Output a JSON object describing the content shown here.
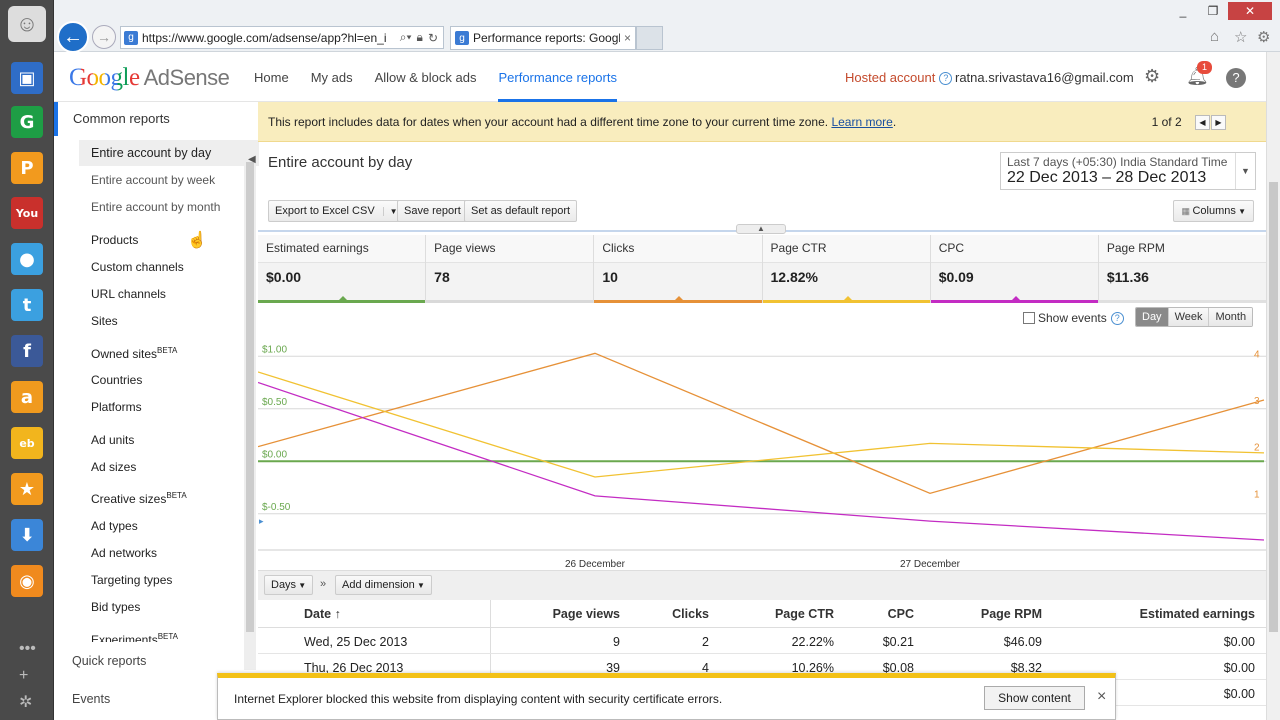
{
  "browser": {
    "url": "https://www.google.com/adsense/app?hl=en_i",
    "tab_title": "Performance reports: Googl...",
    "tab_close": "×"
  },
  "dock_icons": [
    "smiley-icon",
    "mobile-app-icon",
    "g-app-icon",
    "paypal-icon",
    "youtube-icon",
    "apple-icon",
    "twitter-icon",
    "facebook-icon",
    "amazon-icon",
    "ebay-icon",
    "star-icon",
    "download-icon",
    "rss-icon"
  ],
  "header": {
    "logo_google": "Google",
    "logo_product": "AdSense",
    "nav": [
      "Home",
      "My ads",
      "Allow & block ads",
      "Performance reports"
    ],
    "hosted": "Hosted account",
    "help_glyph": "?",
    "email": "ratna.srivastava16@gmail.com",
    "notif_count": "1"
  },
  "sidebar": {
    "common_reports": "Common reports",
    "items": [
      {
        "label": "Entire account by day",
        "selected": true
      },
      {
        "label": "Entire account by week"
      },
      {
        "label": "Entire account by month"
      },
      {
        "label": "Products"
      },
      {
        "label": "Custom channels"
      },
      {
        "label": "URL channels"
      },
      {
        "label": "Sites"
      },
      {
        "label": "Owned sites",
        "sup": "BETA"
      },
      {
        "label": "Countries"
      },
      {
        "label": "Platforms"
      },
      {
        "label": "Ad units"
      },
      {
        "label": "Ad sizes"
      },
      {
        "label": "Creative sizes",
        "sup": "BETA"
      },
      {
        "label": "Ad types"
      },
      {
        "label": "Ad networks"
      },
      {
        "label": "Targeting types"
      },
      {
        "label": "Bid types"
      },
      {
        "label": "Experiments",
        "sup": "BETA"
      }
    ],
    "quick_reports": "Quick reports",
    "events": "Events"
  },
  "banner": {
    "text": "This report includes data for dates when your account had a different time zone to your current time zone.",
    "link": "Learn more",
    "period": ".",
    "pager": "1 of 2"
  },
  "report": {
    "title": "Entire account by day",
    "range_label": "Last 7 days (+05:30) India Standard Time",
    "range_value": "22 Dec 2013 – 28 Dec 2013",
    "export_btn": "Export to Excel CSV",
    "save_btn": "Save report",
    "default_btn": "Set as default report",
    "columns_btn": "Columns"
  },
  "metrics": [
    {
      "name": "Estimated earnings",
      "value": "$0.00",
      "color": "#6aa84f"
    },
    {
      "name": "Page views",
      "value": "78",
      "color": "#d9d9d9"
    },
    {
      "name": "Clicks",
      "value": "10",
      "color": "#e69138"
    },
    {
      "name": "Page CTR",
      "value": "12.82%",
      "color": "#f1c232"
    },
    {
      "name": "CPC",
      "value": "$0.09",
      "color": "#c32cc3"
    },
    {
      "name": "Page RPM",
      "value": "$11.36",
      "color": "#e0e0e0"
    }
  ],
  "controls": {
    "show_events": "Show events",
    "seg": [
      "Day",
      "Week",
      "Month"
    ]
  },
  "chart_data": {
    "type": "line",
    "x": [
      "25 Dec 2013",
      "26 Dec 2013",
      "27 Dec 2013",
      "28 Dec 2013"
    ],
    "x_tick_labels": [
      "26 December",
      "27 December"
    ],
    "left_axis_ticks": [
      "$1.00",
      "$0.50",
      "$0.00",
      "$-0.50"
    ],
    "right_axis_ticks": [
      "4",
      "3",
      "2",
      "1"
    ],
    "ylim_left": [
      -0.75,
      1.25
    ],
    "ylim_right": [
      0,
      4.5
    ],
    "series": [
      {
        "name": "Estimated earnings",
        "color": "#6aa84f",
        "axis": "left",
        "values": [
          0.0,
          0.0,
          0.0,
          0.0
        ]
      },
      {
        "name": "Clicks",
        "color": "#e69138",
        "axis": "right",
        "values": [
          2,
          4,
          1,
          3
        ]
      },
      {
        "name": "Page CTR",
        "color": "#f1c232",
        "axis": "left",
        "values": [
          0.85,
          -0.15,
          0.17,
          0.08
        ]
      },
      {
        "name": "CPC",
        "color": "#c32cc3",
        "axis": "left",
        "values": [
          0.75,
          -0.33,
          -0.57,
          -0.75
        ]
      }
    ]
  },
  "dimensions": {
    "days": "Days",
    "arrow": "»",
    "add": "Add dimension"
  },
  "table": {
    "headers": [
      "Date ↑",
      "Page views",
      "Clicks",
      "Page CTR",
      "CPC",
      "Page RPM",
      "Estimated earnings"
    ],
    "rows": [
      [
        "Wed, 25 Dec 2013",
        "9",
        "2",
        "22.22%",
        "$0.21",
        "$46.09",
        "$0.00"
      ],
      [
        "Thu, 26 Dec 2013",
        "39",
        "4",
        "10.26%",
        "$0.08",
        "$8.32",
        "$0.00"
      ],
      [
        "",
        "",
        "",
        "",
        "",
        "",
        "$0.00"
      ]
    ]
  },
  "iebar": {
    "message": "Internet Explorer blocked this website from displaying content with security certificate errors.",
    "button": "Show content",
    "close": "×"
  }
}
